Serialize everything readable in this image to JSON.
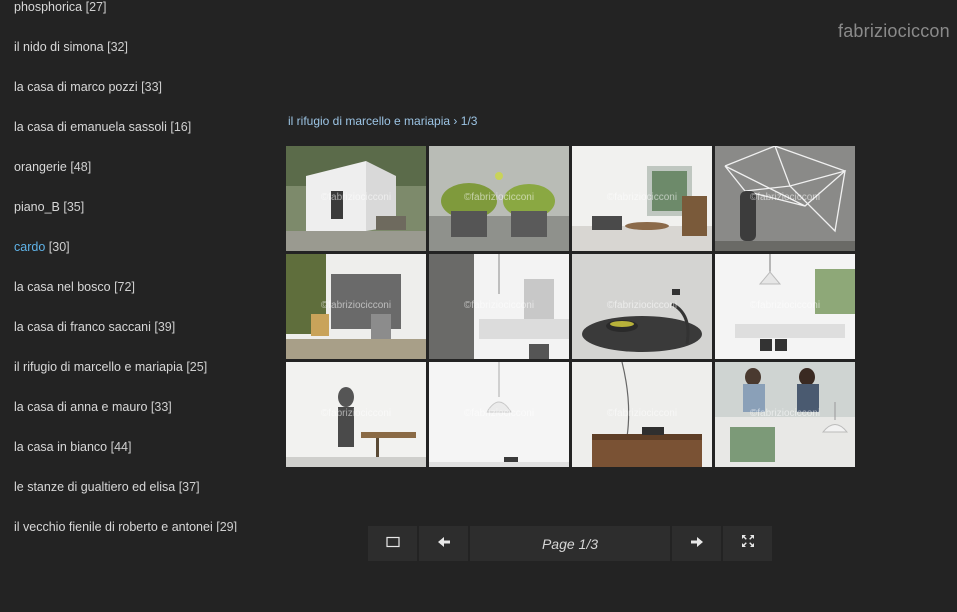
{
  "brand": "fabriziociccon",
  "sidebar": {
    "items": [
      {
        "name": "phosphorica",
        "count": "[27]",
        "active": false
      },
      {
        "name": "il nido di simona",
        "count": "[32]",
        "active": false
      },
      {
        "name": "la casa di marco pozzi",
        "count": "[33]",
        "active": false
      },
      {
        "name": "la casa di emanuela sassoli",
        "count": "[16]",
        "active": false
      },
      {
        "name": "orangerie",
        "count": "[48]",
        "active": false
      },
      {
        "name": "piano_B",
        "count": "[35]",
        "active": false
      },
      {
        "name": "cardo",
        "count": "[30]",
        "active": true
      },
      {
        "name": "la casa nel bosco",
        "count": "[72]",
        "active": false
      },
      {
        "name": "la casa di franco saccani",
        "count": "[39]",
        "active": false
      },
      {
        "name": "il rifugio di marcello e mariapia",
        "count": "[25]",
        "active": false
      },
      {
        "name": "la casa di anna e mauro",
        "count": "[33]",
        "active": false
      },
      {
        "name": "la casa in bianco",
        "count": "[44]",
        "active": false
      },
      {
        "name": "le stanze di gualtiero ed elisa",
        "count": "[37]",
        "active": false
      },
      {
        "name": "il vecchio fienile di roberto e antonei",
        "count": "[29]",
        "active": false
      }
    ]
  },
  "breadcrumb": {
    "gallery": "il rifugio di marcello e mariapia",
    "separator": "›",
    "position": "1/3"
  },
  "watermark": "©fabriziocicconi",
  "thumbnails": [
    {
      "scene": "patio"
    },
    {
      "scene": "plants"
    },
    {
      "scene": "livingroom"
    },
    {
      "scene": "vase"
    },
    {
      "scene": "chairs"
    },
    {
      "scene": "kitchen"
    },
    {
      "scene": "table"
    },
    {
      "scene": "pendant"
    },
    {
      "scene": "person"
    },
    {
      "scene": "lamp"
    },
    {
      "scene": "sideboard"
    },
    {
      "scene": "couple"
    }
  ],
  "controls": {
    "page_label": "Page 1/3",
    "icons": [
      "thumbnail-view-icon",
      "arrow-left-icon",
      "arrow-right-icon",
      "fullscreen-icon"
    ]
  }
}
